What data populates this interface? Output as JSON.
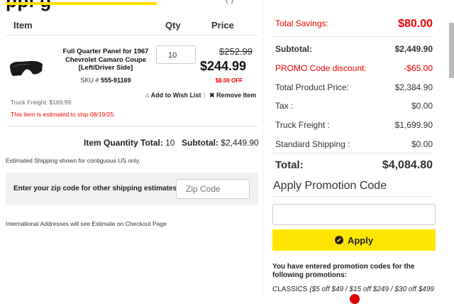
{
  "header": {
    "cols": {
      "item": "Item",
      "qty": "Qty",
      "price": "Price"
    }
  },
  "product": {
    "name": "Full Quarter Panel for 1967 Chevrolet Camaro Coupe [Left/Driver Side]",
    "sku_label": "SKU #",
    "sku": "555-91169",
    "quantity": "10",
    "old_price": "$252.99",
    "new_price": "$244.99",
    "savings": "$8.00 OFF",
    "wish_label": "Add to Wish List",
    "separator": "|",
    "remove_label": "Remove Item",
    "freight": "Truck Freight: $169.99",
    "ship_estimate": "This item is estimated to ship 08/19/25."
  },
  "cart_totals": {
    "qty_label": "Item Quantity Total:",
    "qty_value": "10",
    "subtotal_label": "Subtotal:",
    "subtotal_value": "$2,449.90"
  },
  "shipping": {
    "estimate_note": "Estimated Shipping shown for contiguous US only.",
    "zip_label": "Enter your zip code for other shipping estimates",
    "zip_placeholder": "Zip Code",
    "intl_note": "International Addresses will see Estimate on Checkout Page"
  },
  "summary": {
    "total_savings_label": "Total Savings:",
    "total_savings_value": "$80.00",
    "subtotal_label": "Subtotal:",
    "subtotal_value": "$2,449.90",
    "promo_discount_label": "PROMO Code discount:",
    "promo_discount_value": "-$65.00",
    "product_price_label": "Total Product Price:",
    "product_price_value": "$2,384.90",
    "tax_label": "Tax :",
    "tax_value": "$0.00",
    "freight_label": "Truck Freight :",
    "freight_value": "$1,699.90",
    "std_shipping_label": "Standard Shipping :",
    "std_shipping_value": "$0.00",
    "total_label": "Total:",
    "total_value": "$4,084.80"
  },
  "promo": {
    "title": "Apply Promotion Code",
    "input_value": "",
    "apply_label": "Apply",
    "entered_text": "You have entered promotion codes for the following promotions:",
    "code_name": "CLASSICS",
    "code_desc": "($5 off $49 / $15 off $249 / $30 off $499"
  },
  "colors": {
    "accent": "#ffe600",
    "sale_red": "#e00000"
  },
  "icons": {
    "wish": "home-heart-icon",
    "remove": "close-circle-icon",
    "apply": "check-circle-icon"
  }
}
